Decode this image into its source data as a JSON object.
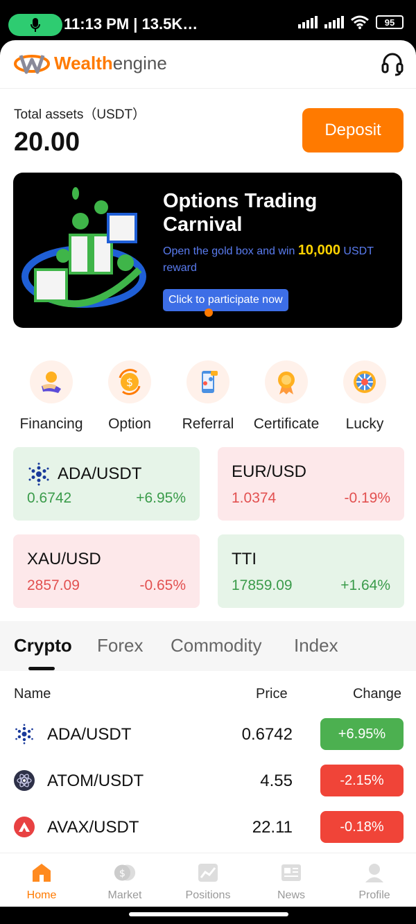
{
  "status_bar": {
    "time_text": "11:13 PM | 13.5K…",
    "battery": "95"
  },
  "header": {
    "logo_bold": "Wealth",
    "logo_rest": "engine"
  },
  "assets": {
    "label": "Total assets（USDT）",
    "value": "20.00",
    "deposit_label": "Deposit"
  },
  "banner": {
    "title_line1": "Options Trading",
    "title_line2": "Carnival",
    "sub_pre": "Open the gold box and win ",
    "sub_amount": "10,000",
    "sub_post": " USDT reward",
    "button_label": "Click to participate now"
  },
  "quick_actions": [
    {
      "label": "Financing",
      "icon": "hand-coin-icon"
    },
    {
      "label": "Option",
      "icon": "exchange-coin-icon"
    },
    {
      "label": "Referral",
      "icon": "share-phone-icon"
    },
    {
      "label": "Certificate",
      "icon": "certificate-badge-icon"
    },
    {
      "label": "Lucky",
      "icon": "lucky-wheel-icon"
    }
  ],
  "tiles": [
    {
      "name": "ADA/USDT",
      "price": "0.6742",
      "change": "+6.95%",
      "trend": "up",
      "icon": "cardano-icon"
    },
    {
      "name": "EUR/USD",
      "price": "1.0374",
      "change": "-0.19%",
      "trend": "down"
    },
    {
      "name": "XAU/USD",
      "price": "2857.09",
      "change": "-0.65%",
      "trend": "down"
    },
    {
      "name": "TTI",
      "price": "17859.09",
      "change": "+1.64%",
      "trend": "up"
    }
  ],
  "market_tabs": [
    {
      "label": "Crypto",
      "active": true
    },
    {
      "label": "Forex",
      "active": false
    },
    {
      "label": "Commodity",
      "active": false
    },
    {
      "label": "Index",
      "active": false
    }
  ],
  "table": {
    "col_name": "Name",
    "col_price": "Price",
    "col_change": "Change",
    "rows": [
      {
        "name": "ADA/USDT",
        "price": "0.6742",
        "change": "+6.95%",
        "trend": "up",
        "icon": "cardano-icon"
      },
      {
        "name": "ATOM/USDT",
        "price": "4.55",
        "change": "-2.15%",
        "trend": "down",
        "icon": "cosmos-icon"
      },
      {
        "name": "AVAX/USDT",
        "price": "22.11",
        "change": "-0.18%",
        "trend": "down",
        "icon": "avalanche-icon"
      }
    ]
  },
  "bottom_nav": [
    {
      "label": "Home",
      "active": true
    },
    {
      "label": "Market",
      "active": false
    },
    {
      "label": "Positions",
      "active": false
    },
    {
      "label": "News",
      "active": false
    },
    {
      "label": "Profile",
      "active": false
    }
  ],
  "colors": {
    "accent": "#ff7a00",
    "up": "#4cb050",
    "down": "#f04438",
    "up_bg": "#e6f4e8",
    "down_bg": "#fde8ea"
  }
}
